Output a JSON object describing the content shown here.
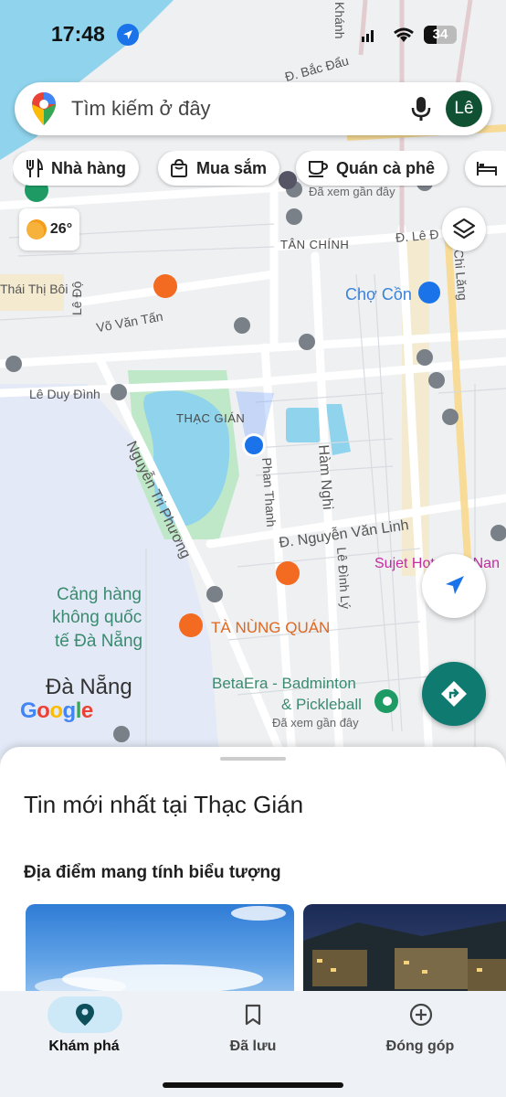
{
  "status_bar": {
    "time": "17:48",
    "battery": "34"
  },
  "search": {
    "placeholder": "Tìm kiếm ở đây",
    "avatar_initial": "Lê"
  },
  "chips": [
    {
      "label": "Nhà hàng",
      "icon": "fork-knife-icon"
    },
    {
      "label": "Mua sắm",
      "icon": "shopping-bag-icon"
    },
    {
      "label": "Quán cà phê",
      "icon": "coffee-cup-icon"
    },
    {
      "label": "",
      "icon": "bed-icon"
    }
  ],
  "weather": {
    "temp": "26°",
    "icon": "partly-sunny-icon"
  },
  "map": {
    "labels": {
      "khanh": "Khánh",
      "bac_dau": "Đ. Bắc Đẩu",
      "da_xem_1": "Đã xem gần đây",
      "tan_chinh": "TÂN CHÍNH",
      "le_do_e": "Đ. Lê Đ",
      "chi_lang": "Chi Lăng",
      "thai_thi_boi": "Thái Thị Bôi",
      "cho_con": "Chợ Cồn",
      "le_do": "Lê Độ",
      "vo_van_tan": "Võ Văn Tấn",
      "le_duy_dinh": "Lê Duy Đình",
      "thac_gian": "THẠC GIÁN",
      "nguyen_tri_phuong": "Nguyễn Tri Phương",
      "phan_thanh": "Phan Thanh",
      "ham_nghi": "Hàm Nghi",
      "nguyen_van_linh": "Đ. Nguyễn Văn Linh",
      "le_dinh_ly": "Lê Đình Lý",
      "sujet": "Sujet Hotel Da Nan",
      "cang_hang_1": "Cảng hàng",
      "cang_hang_2": "không quốc",
      "cang_hang_3": "tế Đà Nẵng",
      "ta_nung": "TÀ NÙNG QUÁN",
      "da_nang": "Đà Nẵng",
      "betaera_1": "BetaEra - Badminton",
      "betaera_2": "& Pickleball",
      "da_xem_2": "Đã xem gần đây"
    }
  },
  "google_logo": "Google",
  "sheet": {
    "title": "Tin mới nhất tại Thạc Gián",
    "subtitle": "Địa điểm mang tính biểu tượng"
  },
  "nav": [
    {
      "label": "Khám phá",
      "icon": "pin-icon",
      "active": true
    },
    {
      "label": "Đã lưu",
      "icon": "bookmark-icon",
      "active": false
    },
    {
      "label": "Đóng góp",
      "icon": "plus-circle-icon",
      "active": false
    }
  ],
  "colors": {
    "accent": "#1a73e8",
    "fab_direction": "#0e7a70",
    "nav_active_pill": "#cde8f6",
    "avatar_bg": "#0f5132"
  }
}
